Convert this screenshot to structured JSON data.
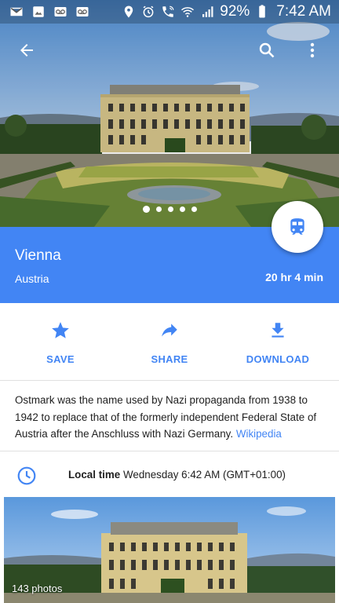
{
  "status_bar": {
    "left_icons": [
      "mail-icon",
      "image-icon",
      "voicemail-icon",
      "voicemail-icon"
    ],
    "right_icons": [
      "location-icon",
      "alarm-icon",
      "wifi-calling-icon",
      "wifi-icon",
      "signal-icon",
      "battery-icon"
    ],
    "battery": "92%",
    "time": "7:42 AM"
  },
  "app_bar": {
    "back_icon": "arrow-left-icon",
    "search_icon": "search-icon",
    "more_icon": "more-vert-icon"
  },
  "gallery": {
    "page_count": 5,
    "current_page": 1
  },
  "place": {
    "name": "Vienna",
    "region": "Austria",
    "travel_time": "20 hr 4 min",
    "travel_mode_icon": "train-icon"
  },
  "actions": {
    "save": "SAVE",
    "share": "SHARE",
    "download": "DOWNLOAD"
  },
  "description": {
    "text": "Ostmark was the name used by Nazi propaganda from 1938 to 1942 to replace that of the formerly independent Federal State of Austria after the Anschluss with Nazi Germany.",
    "source_link": "Wikipedia"
  },
  "local_time": {
    "label": "Local time",
    "value": "Wednesday 6:42 AM (GMT+01:00)"
  },
  "photos": {
    "count_label": "143 photos"
  },
  "colors": {
    "accent": "#4285f4",
    "text_primary": "#212121",
    "divider": "#e0e0e0"
  }
}
